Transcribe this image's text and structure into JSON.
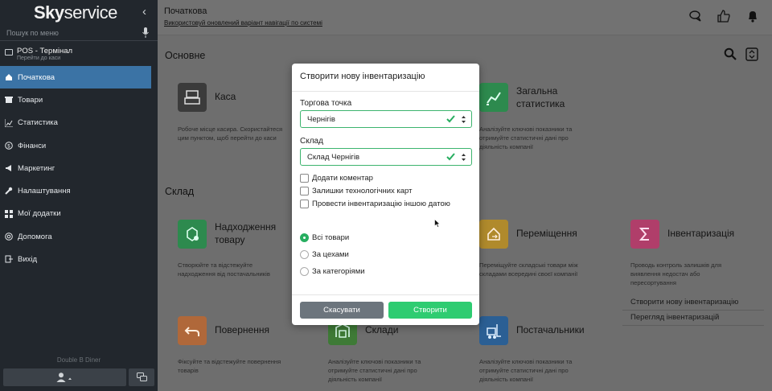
{
  "sidebar": {
    "logo_a": "Sky",
    "logo_b": "service",
    "search_placeholder": "Пошук по меню",
    "pos_title": "POS - Термінал",
    "pos_sub": "Перейти до каси",
    "items": [
      {
        "label": "Початкова",
        "icon": "home-icon"
      },
      {
        "label": "Товари",
        "icon": "box-icon"
      },
      {
        "label": "Статистика",
        "icon": "chart-icon"
      },
      {
        "label": "Фінанси",
        "icon": "coin-icon"
      },
      {
        "label": "Маркетинг",
        "icon": "megaphone-icon"
      },
      {
        "label": "Налаштування",
        "icon": "wrench-icon"
      },
      {
        "label": "Мої додатки",
        "icon": "grid-icon"
      },
      {
        "label": "Допомога",
        "icon": "help-icon"
      },
      {
        "label": "Вихід",
        "icon": "exit-icon"
      }
    ],
    "company": "Double B Diner"
  },
  "header": {
    "title": "Початкова",
    "hint": "Використовуй оновлений варіант навігації по системі"
  },
  "sections": {
    "main": "Основне",
    "warehouse": "Склад"
  },
  "cards": {
    "kasa": {
      "name": "Каса",
      "desc": "Робоче місце касира. Скористайтеся цим пунктом, щоб перейти до каси"
    },
    "stats": {
      "name1": "Загальна",
      "name2": "статистика",
      "desc": "Аналізуйте ключові показники та отримуйте статистичні дані про діяльність компанії"
    },
    "income": {
      "name1": "Надходження",
      "name2": "товару",
      "desc": "Створюйте та відстежуйте надходження від постачальників"
    },
    "move": {
      "name": "Переміщення",
      "desc": "Переміщуйте складські товари між складами всередині своєї компанії"
    },
    "inventory": {
      "name": "Інвентаризація",
      "desc": "Проводь контроль залишків для виявлення недостач або пересортування"
    },
    "return": {
      "name": "Повернення",
      "desc": "Фіксуйте та відстежуйте повернення товарів"
    },
    "stores": {
      "name": "Склади",
      "desc": "Аналізуйте ключові показники та отримуйте статистичні дані про діяльність компанії"
    },
    "suppliers": {
      "name": "Постачальники",
      "desc": "Аналізуйте ключові показники та отримуйте статистичні дані про діяльність компанії"
    }
  },
  "inventory_links": {
    "create": "Створити нову інвентаризацію",
    "view": "Перегляд інвентаризацій"
  },
  "modal": {
    "title": "Створити нову інвентаризацію",
    "store_label": "Торгова точка",
    "store_value": "Чернігів",
    "warehouse_label": "Склад",
    "warehouse_value": "Склад Чернігів",
    "checkboxes": [
      "Додати коментар",
      "Залишки технологічних карт",
      "Провести інвентаризацію іншою датою"
    ],
    "radios": [
      "Всі товари",
      "За цехами",
      "За категоріями"
    ],
    "selected_radio": "Всі товари",
    "cancel": "Скасувати",
    "create": "Створити"
  },
  "colors": {
    "accent": "#3b73a5",
    "success": "#2ecc71",
    "sidebar_bg": "#22272d"
  }
}
